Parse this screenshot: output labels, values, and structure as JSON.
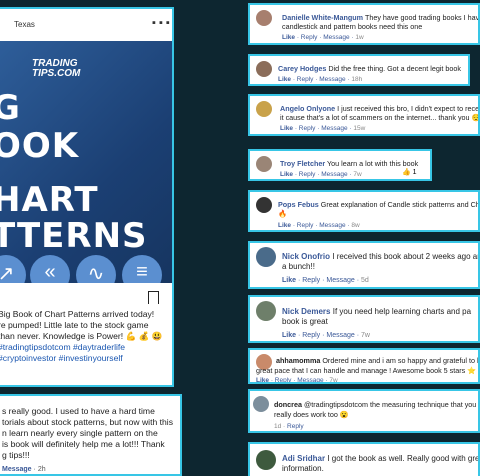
{
  "post": {
    "location": "Texas",
    "more_icon": "three-dots-icon",
    "book": {
      "brand_line1": "TRADING",
      "brand_line2": "TIPS.COM",
      "title_lines": [
        "G",
        "OOK",
        "HART",
        "TTERNS"
      ]
    },
    "caption_lines": [
      "Big Book of Chart Patterns arrived today!",
      "re pumped!  Little late to the stock game",
      "than never.  Knowledge is Power! 💪 💰 😃"
    ],
    "hashtags": [
      "#tradingtipsdotcom #daytraderlife",
      "#cryptoinvestor #investinyourself"
    ]
  },
  "comment_left": {
    "text_lines": [
      "s really good. I used to have a hard time",
      "torials about stock patterns, but now with this",
      "n learn nearly every single pattern on the",
      "is book will definitely help me a lot!!! Thank",
      "g tips!!!"
    ],
    "actions": "Message",
    "time": "2h"
  },
  "comments": [
    {
      "name": "Danielle White-Mangum",
      "lines": [
        "They have good trading books I have th",
        "candlestick and pattern books need this one"
      ],
      "like": "Like",
      "reply": "Reply",
      "message": "Message",
      "time": "1w"
    },
    {
      "name": "Carey Hodges",
      "lines": [
        "Did the free thing. Got a decent legit book"
      ],
      "like": "Like",
      "reply": "Reply",
      "message": "Message",
      "time": "18h"
    },
    {
      "name": "Angelo Onlyone",
      "lines": [
        "I just received this bro, I didn't expect to receive",
        "it cause that's a lot of scammers on the internet... thank you 😌"
      ],
      "like": "Like",
      "reply": "Reply",
      "message": "Message",
      "time": "15w"
    },
    {
      "name": "Troy Fletcher",
      "lines": [
        "You learn a lot with this book"
      ],
      "like": "Like",
      "reply": "Reply",
      "message": "Message",
      "time": "7w",
      "reactions": "1"
    },
    {
      "name": "Pops Febus",
      "lines": [
        "Great explanation of Candle stick patterns and Charts",
        "🔥"
      ],
      "like": "Like",
      "reply": "Reply",
      "message": "Message",
      "time": "8w"
    },
    {
      "name": "Nick Onofrio",
      "lines": [
        "I received this book about 2 weeks ago an",
        "a bunch!!"
      ],
      "like": "Like",
      "reply": "Reply",
      "message": "Message",
      "time": "5d"
    },
    {
      "name": "Nick Demers",
      "lines": [
        "If you need help learning charts and pa",
        "book is great"
      ],
      "like": "Like",
      "reply": "Reply",
      "message": "Message",
      "time": "7w"
    },
    {
      "name": "ahhamomma",
      "lines": [
        "Ordered mine and i am so happy and grateful to be s",
        "great pace that I can handle and manage ! Awesome book 5 stars ⭐"
      ],
      "like": "Like",
      "reply": "Reply",
      "message": "Message",
      "time": "7w"
    },
    {
      "name": "doncrea",
      "lines": [
        "@tradingtipsdotcom the measuring technique that you m",
        "really does work too 😮"
      ],
      "like": "",
      "reply": "Reply",
      "message": "",
      "time": "1d"
    },
    {
      "name": "Adi Sridhar",
      "lines": [
        "I got the book as well. Really good with grea",
        "information."
      ],
      "like": "",
      "reply": "",
      "message": "",
      "time": ""
    }
  ]
}
